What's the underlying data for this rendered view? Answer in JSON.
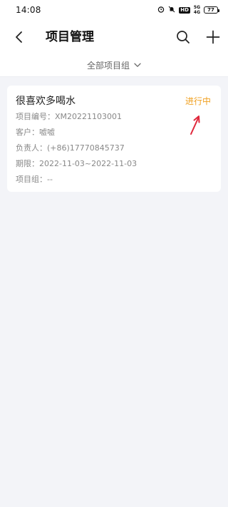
{
  "status_bar": {
    "time": "14:08",
    "hd": "HD",
    "signal_top": "5G",
    "signal_bottom": "4G",
    "battery": "77"
  },
  "header": {
    "title": "项目管理"
  },
  "filter": {
    "label": "全部项目组"
  },
  "project": {
    "title": "很喜欢多喝水",
    "status": "进行中",
    "status_color": "#f0a020",
    "rows": [
      {
        "label": "项目编号：",
        "value": "XM20221103001"
      },
      {
        "label": "客户：",
        "value": "嘘嘘"
      },
      {
        "label": "负责人：",
        "value": "(+86)17770845737"
      },
      {
        "label": "期限：",
        "value": "2022-11-03~2022-11-03"
      },
      {
        "label": "项目组：",
        "value": "--"
      }
    ]
  },
  "colors": {
    "background": "#f3f4f8",
    "card": "#ffffff",
    "annotation_arrow": "#e0283c"
  }
}
